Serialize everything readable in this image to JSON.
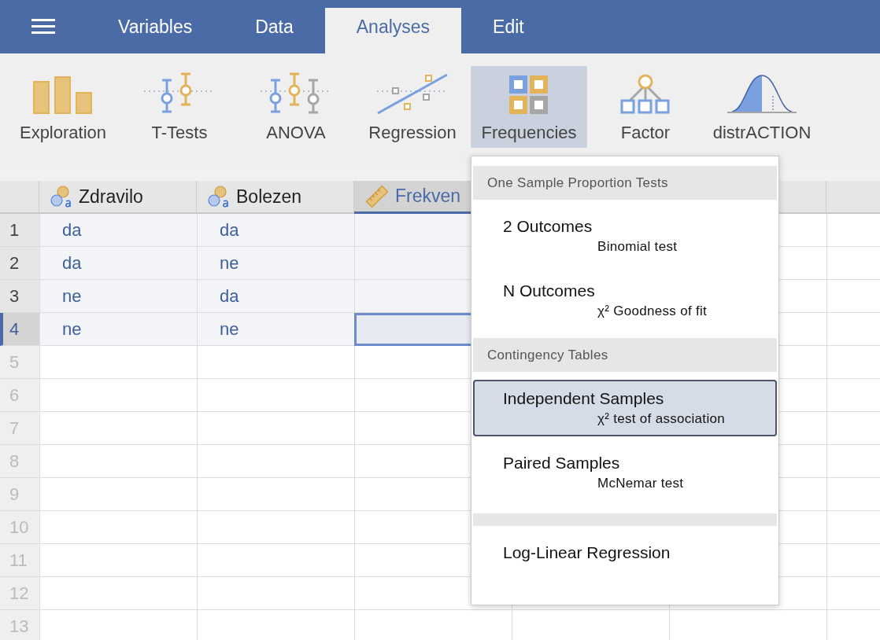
{
  "tabs": [
    {
      "label": "Variables",
      "selected": false
    },
    {
      "label": "Data",
      "selected": false
    },
    {
      "label": "Analyses",
      "selected": true
    },
    {
      "label": "Edit",
      "selected": false
    }
  ],
  "toolbar": [
    {
      "label": "Exploration",
      "kind": "bars",
      "selected": false
    },
    {
      "label": "T-Tests",
      "kind": "ttest",
      "selected": false
    },
    {
      "label": "ANOVA",
      "kind": "anova",
      "selected": false
    },
    {
      "label": "Regression",
      "kind": "regression",
      "selected": false
    },
    {
      "label": "Frequencies",
      "kind": "frequencies",
      "selected": true
    },
    {
      "label": "Factor",
      "kind": "factor",
      "selected": false
    },
    {
      "label": "distrACTION",
      "kind": "distribution",
      "selected": false
    }
  ],
  "columns": [
    {
      "name": "Zdravilo",
      "kind": "nominal",
      "selected": false
    },
    {
      "name": "Bolezen",
      "kind": "nominal",
      "selected": false
    },
    {
      "name": "Frekven",
      "kind": "continuous",
      "selected": true
    }
  ],
  "rows": [
    {
      "number": "1",
      "selected": false,
      "cells": [
        {
          "text": "da",
          "selected": false
        },
        {
          "text": "da",
          "selected": false
        },
        {
          "selected": false
        }
      ]
    },
    {
      "number": "2",
      "selected": false,
      "cells": [
        {
          "text": "da",
          "selected": false
        },
        {
          "text": "ne",
          "selected": false
        },
        {
          "selected": false
        }
      ]
    },
    {
      "number": "3",
      "selected": false,
      "cells": [
        {
          "text": "ne",
          "selected": false
        },
        {
          "text": "da",
          "selected": false
        },
        {
          "selected": false
        }
      ]
    },
    {
      "number": "4",
      "selected": true,
      "cells": [
        {
          "text": "ne",
          "selected": false
        },
        {
          "text": "ne",
          "selected": false
        },
        {
          "selected": true
        }
      ]
    },
    {
      "number": "5",
      "selected": false
    },
    {
      "number": "6",
      "selected": false
    },
    {
      "number": "7",
      "selected": false
    },
    {
      "number": "8",
      "selected": false
    },
    {
      "number": "9",
      "selected": false
    },
    {
      "number": "10",
      "selected": false
    },
    {
      "number": "11",
      "selected": false
    },
    {
      "number": "12",
      "selected": false
    },
    {
      "number": "13",
      "selected": false
    }
  ],
  "menu": {
    "sections": [
      {
        "title": "One Sample Proportion Tests",
        "items": [
          {
            "title": "2 Outcomes",
            "subtitle": "Binomial test",
            "selected": false
          },
          {
            "title": "N Outcomes",
            "subtitle": "χ² Goodness of fit",
            "selected": false
          }
        ]
      },
      {
        "title": "Contingency Tables",
        "items": [
          {
            "title": "Independent Samples",
            "subtitle": "χ² test of association",
            "selected": true
          },
          {
            "title": "Paired Samples",
            "subtitle": "McNemar test",
            "selected": false
          }
        ]
      },
      {
        "items": [
          {
            "title": "Log-Linear Regression",
            "selected": false
          }
        ]
      }
    ]
  }
}
